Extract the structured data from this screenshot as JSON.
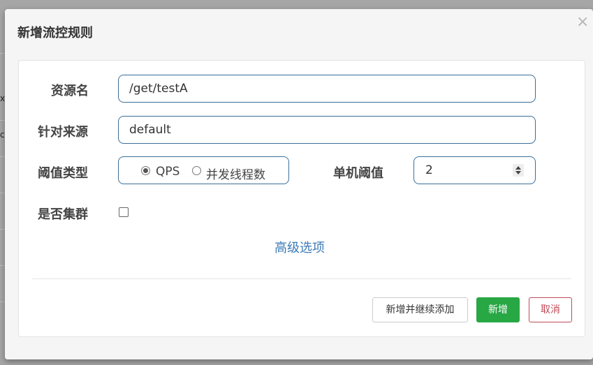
{
  "background": {
    "fragments": [
      "x",
      "c"
    ]
  },
  "dialog": {
    "title": "新增流控规则",
    "close_symbol": "×"
  },
  "form": {
    "resource_label": "资源名",
    "resource_value": "/get/testA",
    "source_label": "针对来源",
    "source_value": "default",
    "threshold_type_label": "阈值类型",
    "threshold_type_options": [
      "QPS",
      "并发线程数"
    ],
    "threshold_type_selected": "QPS",
    "single_threshold_label": "单机阈值",
    "single_threshold_value": "2",
    "cluster_label": "是否集群",
    "cluster_checked": false,
    "advanced_link": "高级选项"
  },
  "footer": {
    "add_continue_label": "新增并继续添加",
    "add_label": "新增",
    "cancel_label": "取消"
  },
  "colors": {
    "accent_border": "#3a6f9a",
    "link": "#3d7ab6",
    "success": "#28a745",
    "danger": "#c04a57"
  }
}
